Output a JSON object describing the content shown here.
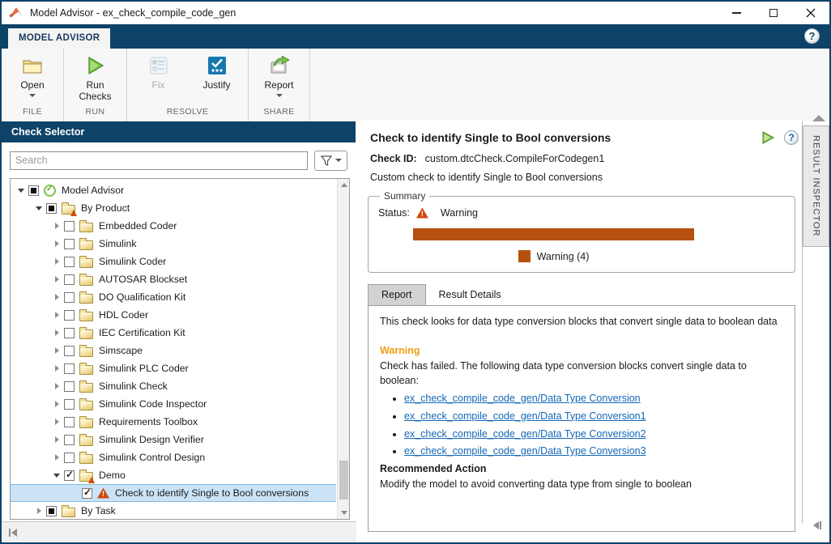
{
  "window": {
    "title": "Model Advisor - ex_check_compile_code_gen"
  },
  "ribbon": {
    "tab_label": "MODEL ADVISOR"
  },
  "toolbar": {
    "groups": [
      {
        "label": "FILE",
        "buttons": [
          {
            "label": "Open",
            "icon": "open-folder-icon",
            "dropdown": true,
            "enabled": true
          }
        ]
      },
      {
        "label": "RUN",
        "buttons": [
          {
            "label": "Run Checks",
            "icon": "run-checks-icon",
            "dropdown": false,
            "enabled": true
          }
        ]
      },
      {
        "label": "RESOLVE",
        "buttons": [
          {
            "label": "Fix",
            "icon": "fix-icon",
            "dropdown": false,
            "enabled": false
          },
          {
            "label": "Justify",
            "icon": "justify-icon",
            "dropdown": false,
            "enabled": true
          }
        ]
      },
      {
        "label": "SHARE",
        "buttons": [
          {
            "label": "Report",
            "icon": "report-icon",
            "dropdown": true,
            "enabled": true
          }
        ]
      }
    ]
  },
  "left_panel": {
    "header": "Check Selector",
    "search": {
      "placeholder": "Search"
    },
    "tree": [
      {
        "label": "Model Advisor",
        "level": 0,
        "arrow": "open",
        "checkbox": "partial",
        "icon": "model-advisor-pass-icon",
        "selected": false
      },
      {
        "label": "By Product",
        "level": 1,
        "arrow": "open",
        "checkbox": "partial",
        "icon": "folder-warning-icon",
        "selected": false
      },
      {
        "label": "Embedded Coder",
        "level": 2,
        "arrow": "closed",
        "checkbox": "empty",
        "icon": "folder-icon",
        "selected": false
      },
      {
        "label": "Simulink",
        "level": 2,
        "arrow": "closed",
        "checkbox": "empty",
        "icon": "folder-icon",
        "selected": false
      },
      {
        "label": "Simulink Coder",
        "level": 2,
        "arrow": "closed",
        "checkbox": "empty",
        "icon": "folder-icon",
        "selected": false
      },
      {
        "label": "AUTOSAR Blockset",
        "level": 2,
        "arrow": "closed",
        "checkbox": "empty",
        "icon": "folder-icon",
        "selected": false
      },
      {
        "label": "DO Qualification Kit",
        "level": 2,
        "arrow": "closed",
        "checkbox": "empty",
        "icon": "folder-icon",
        "selected": false
      },
      {
        "label": "HDL Coder",
        "level": 2,
        "arrow": "closed",
        "checkbox": "empty",
        "icon": "folder-icon",
        "selected": false
      },
      {
        "label": "IEC Certification Kit",
        "level": 2,
        "arrow": "closed",
        "checkbox": "empty",
        "icon": "folder-icon",
        "selected": false
      },
      {
        "label": "Simscape",
        "level": 2,
        "arrow": "closed",
        "checkbox": "empty",
        "icon": "folder-icon",
        "selected": false
      },
      {
        "label": "Simulink PLC Coder",
        "level": 2,
        "arrow": "closed",
        "checkbox": "empty",
        "icon": "folder-icon",
        "selected": false
      },
      {
        "label": "Simulink Check",
        "level": 2,
        "arrow": "closed",
        "checkbox": "empty",
        "icon": "folder-icon",
        "selected": false
      },
      {
        "label": "Simulink Code Inspector",
        "level": 2,
        "arrow": "closed",
        "checkbox": "empty",
        "icon": "folder-icon",
        "selected": false
      },
      {
        "label": "Requirements Toolbox",
        "level": 2,
        "arrow": "closed",
        "checkbox": "empty",
        "icon": "folder-icon",
        "selected": false
      },
      {
        "label": "Simulink Design Verifier",
        "level": 2,
        "arrow": "closed",
        "checkbox": "empty",
        "icon": "folder-icon",
        "selected": false
      },
      {
        "label": "Simulink Control Design",
        "level": 2,
        "arrow": "closed",
        "checkbox": "empty",
        "icon": "folder-icon",
        "selected": false
      },
      {
        "label": "Demo",
        "level": 2,
        "arrow": "open",
        "checkbox": "checked",
        "icon": "folder-warning-icon",
        "selected": false
      },
      {
        "label": "Check to identify Single to Bool conversions",
        "level": 3,
        "arrow": "none",
        "checkbox": "checked",
        "icon": "warning-icon",
        "selected": true
      },
      {
        "label": "By Task",
        "level": 1,
        "arrow": "closed",
        "checkbox": "partial",
        "icon": "folder-icon",
        "selected": false
      }
    ]
  },
  "right_panel": {
    "title": "Check to identify Single to Bool conversions",
    "check_id_label": "Check ID:",
    "check_id": "custom.dtcCheck.CompileForCodegen1",
    "description": "Custom check to identify Single to Bool conversions",
    "summary": {
      "legend": "Summary",
      "status_label": "Status:",
      "status": "Warning",
      "warning_count": 4,
      "bar_color": "#b5500e",
      "legend_label": "Warning (4)"
    },
    "tabs": [
      {
        "label": "Report",
        "active": true
      },
      {
        "label": "Result Details",
        "active": false
      }
    ],
    "report": {
      "intro": "This check looks for data type conversion blocks that convert single data to boolean data",
      "warning_heading": "Warning",
      "failure_text": "Check has failed. The following data type conversion blocks convert single data to boolean:",
      "links": [
        "ex_check_compile_code_gen/Data Type Conversion",
        "ex_check_compile_code_gen/Data Type Conversion1",
        "ex_check_compile_code_gen/Data Type Conversion2",
        "ex_check_compile_code_gen/Data Type Conversion3"
      ],
      "recommended_heading": "Recommended Action",
      "recommended_text": "Modify the model to avoid converting data type from single to boolean"
    }
  },
  "side_panel": {
    "tab_label": "RESULT INSPECTOR"
  },
  "colors": {
    "accent_navy": "#0e4268",
    "warning_bar": "#b5500e",
    "warning_heading": "#efa012",
    "link": "#1467b8",
    "selection_bg": "#cbe3f7"
  }
}
